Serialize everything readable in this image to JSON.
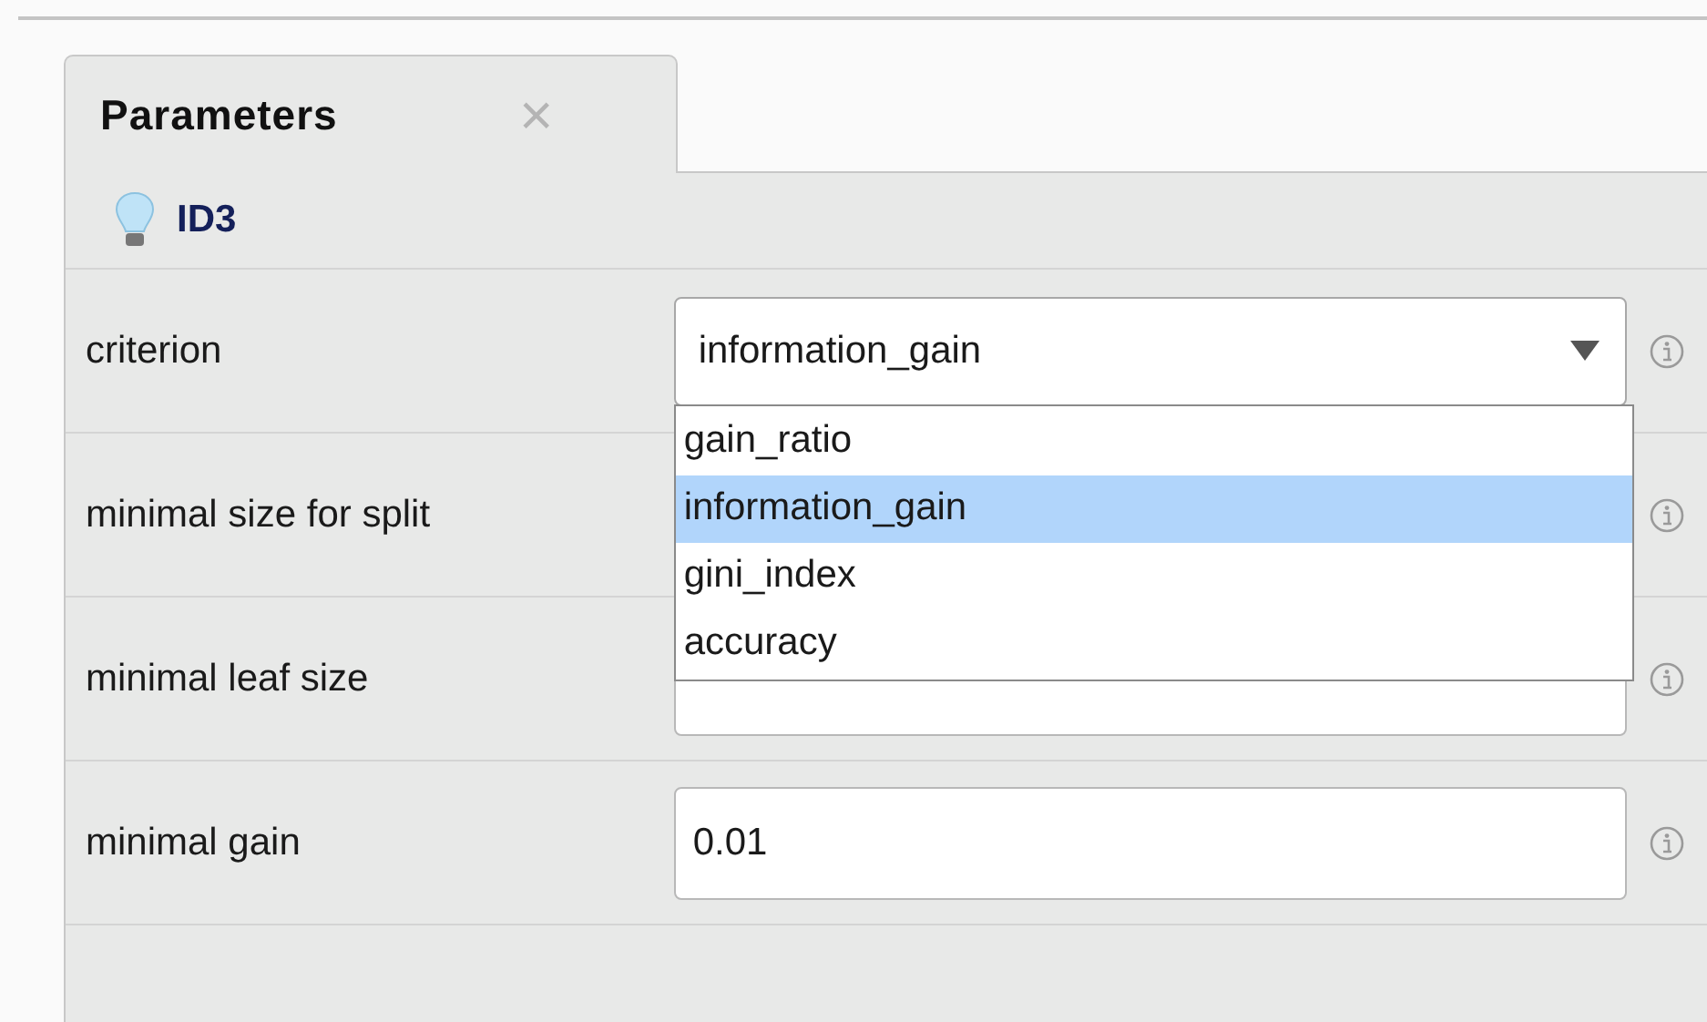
{
  "tab": {
    "label": "Parameters",
    "close": "×"
  },
  "operator": {
    "name": "ID3"
  },
  "parameters": [
    {
      "label": "criterion",
      "kind": "select",
      "value": "information_gain",
      "expanded": true,
      "options": [
        {
          "label": "gain_ratio",
          "selected": false
        },
        {
          "label": "information_gain",
          "selected": true
        },
        {
          "label": "gini_index",
          "selected": false
        },
        {
          "label": "accuracy",
          "selected": false
        }
      ]
    },
    {
      "label": "minimal size for split",
      "kind": "text"
    },
    {
      "label": "minimal leaf size",
      "kind": "text"
    },
    {
      "label": "minimal gain",
      "kind": "text",
      "value": "0.01"
    }
  ]
}
